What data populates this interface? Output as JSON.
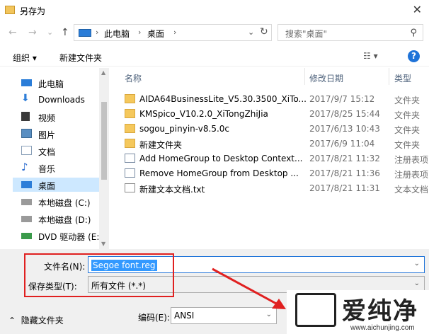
{
  "window": {
    "title": "另存为",
    "close_glyph": "✕"
  },
  "nav": {
    "back": "←",
    "forward": "→",
    "recent": "⌄",
    "up": "↑",
    "path": [
      "此电脑",
      "桌面"
    ],
    "search_placeholder": "搜索\"桌面\""
  },
  "toolbar": {
    "organize": "组织 ▾",
    "new_folder": "新建文件夹",
    "view_glyph": "☷ ▾",
    "help": "?"
  },
  "sidebar": {
    "items": [
      {
        "label": "此电脑",
        "icon": "monitor-icon",
        "color": "#2b7dd8"
      },
      {
        "label": "Downloads",
        "icon": "download-icon",
        "color": "#2f7ed8"
      },
      {
        "label": "视频",
        "icon": "video-icon",
        "color": "#3a3a3a"
      },
      {
        "label": "图片",
        "icon": "picture-icon",
        "color": "#5a8fc2"
      },
      {
        "label": "文档",
        "icon": "document-icon",
        "color": "#8aa0b8"
      },
      {
        "label": "音乐",
        "icon": "music-icon",
        "color": "#2f6fd0"
      },
      {
        "label": "桌面",
        "icon": "desktop-icon",
        "color": "#2b7dd8",
        "selected": true
      },
      {
        "label": "本地磁盘 (C:)",
        "icon": "drive-icon",
        "color": "#6d6d6d"
      },
      {
        "label": "本地磁盘 (D:)",
        "icon": "drive-icon",
        "color": "#6d6d6d"
      },
      {
        "label": "DVD 驱动器 (E:)",
        "icon": "dvd-icon",
        "color": "#3a9a4a"
      }
    ]
  },
  "columns": {
    "name": "名称",
    "date": "修改日期",
    "type": "类型"
  },
  "files": [
    {
      "name": "AIDA64BusinessLite_V5.30.3500_XiTo...",
      "date": "2017/9/7 15:12",
      "type": "文件夹",
      "kind": "folder"
    },
    {
      "name": "KMSpico_V10.2.0_XiTongZhiJia",
      "date": "2017/8/25 15:44",
      "type": "文件夹",
      "kind": "folder"
    },
    {
      "name": "sogou_pinyin-v8.5.0c",
      "date": "2017/6/13 10:43",
      "type": "文件夹",
      "kind": "folder"
    },
    {
      "name": "新建文件夹",
      "date": "2017/6/9 11:04",
      "type": "文件夹",
      "kind": "folder"
    },
    {
      "name": "Add HomeGroup to Desktop Context...",
      "date": "2017/8/21 11:32",
      "type": "注册表项",
      "kind": "reg"
    },
    {
      "name": "Remove HomeGroup from Desktop ...",
      "date": "2017/8/21 11:36",
      "type": "注册表项",
      "kind": "reg"
    },
    {
      "name": "新建文本文档.txt",
      "date": "2017/8/21 11:31",
      "type": "文本文档",
      "kind": "txt"
    }
  ],
  "form": {
    "filename_label": "文件名(N):",
    "filename_value": "Segoe font.reg",
    "filetype_label": "保存类型(T):",
    "filetype_value": "所有文件  (*.*)",
    "hide_folders": "隐藏文件夹",
    "encoding_label": "编码(E):",
    "encoding_value": "ANSI"
  },
  "watermark": {
    "text": "爱纯净",
    "url": "www.aichunjing.com"
  },
  "colors": {
    "selection": "#cde8ff",
    "highlight": "#3399ff",
    "annotation": "#e02020",
    "accent": "#1f73d8"
  }
}
